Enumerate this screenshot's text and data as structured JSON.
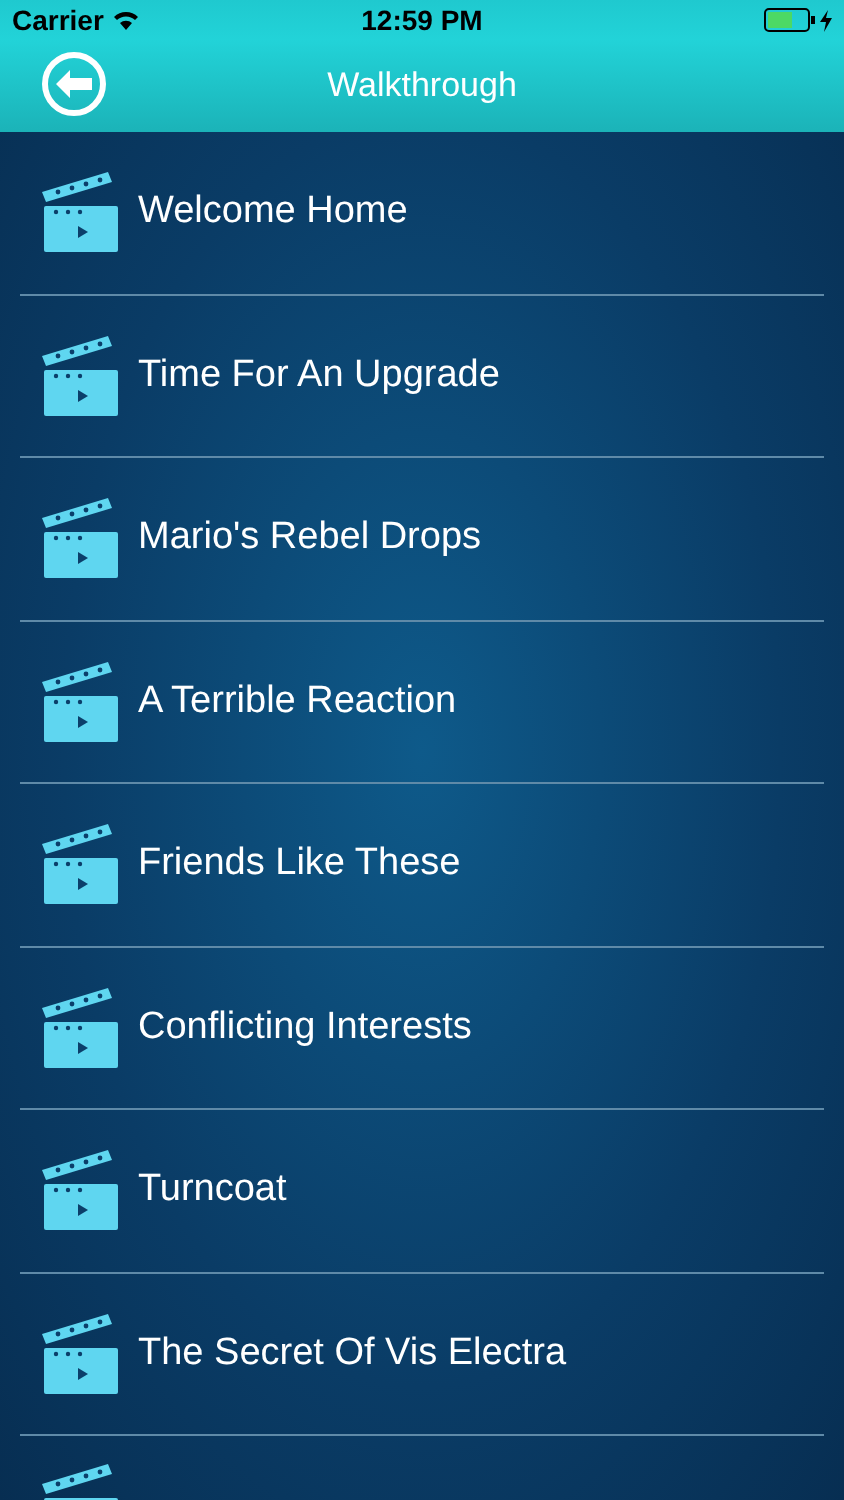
{
  "status_bar": {
    "carrier": "Carrier",
    "time": "12:59 PM"
  },
  "nav_bar": {
    "title": "Walkthrough"
  },
  "items": [
    {
      "kind": "entry",
      "title": "Welcome Home"
    },
    {
      "kind": "entry",
      "title": "Time For An Upgrade"
    },
    {
      "kind": "entry",
      "title": "Mario's Rebel Drops"
    },
    {
      "kind": "entry",
      "title": "A Terrible Reaction"
    },
    {
      "kind": "entry",
      "title": "Friends Like These"
    },
    {
      "kind": "entry",
      "title": "Conflicting Interests"
    },
    {
      "kind": "entry",
      "title": "Turncoat"
    },
    {
      "kind": "entry",
      "title": "The Secret Of Vis Electra"
    },
    {
      "kind": "partial"
    }
  ]
}
